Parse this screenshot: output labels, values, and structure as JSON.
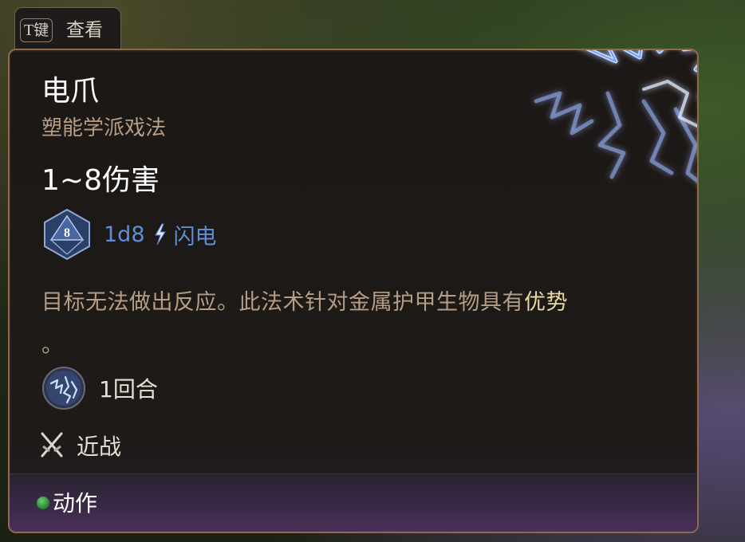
{
  "hint": {
    "key": "T",
    "key_suffix": "键",
    "label": "查看"
  },
  "spell": {
    "name": "电爪",
    "school": "塑能学派戏法",
    "damage": "1~8伤害",
    "dice_face": "8",
    "dice_formula": "1d8",
    "damage_type": "闪电",
    "description_main": "目标无法做出反应。此法术针对金属护甲生物具有",
    "description_keyword": "优势",
    "description_tail": "。",
    "duration": "1回合",
    "range": "近战",
    "action_type": "动作"
  },
  "colors": {
    "panel_border": "#8f6a4b",
    "school_text": "#b59e85",
    "lightning_blue": "#5f8ed8",
    "keyword_highlight": "#e9d8a2",
    "action_dot": "#2e8a3a"
  },
  "icons": {
    "spell_art": "lightning-claw-icon",
    "dice": "d8-dice-icon",
    "damage_type": "lightning-bolt-icon",
    "duration": "spell-portrait-icon",
    "range": "crossed-swords-icon"
  }
}
